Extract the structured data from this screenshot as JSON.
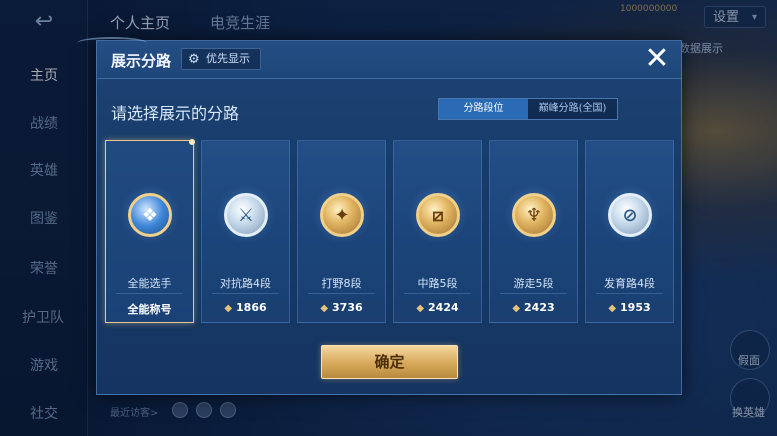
{
  "background": {
    "tabs": [
      "个人主页",
      "电竞生涯"
    ],
    "sidebar": [
      "主页",
      "战绩",
      "英雄",
      "图鉴",
      "荣誉",
      "护卫队",
      "游戏",
      "社交"
    ],
    "settings": "设置",
    "top_badge": "1000000000",
    "data_show": "和数据展示",
    "right_btn_1": "假面",
    "right_btn_2": "换英雄",
    "recent_visitors": "最近访客>"
  },
  "modal": {
    "title": "展示分路",
    "priority_label": "优先显示",
    "subtitle": "请选择展示的分路",
    "seg": [
      "分路段位",
      "巅峰分路(全国)"
    ],
    "confirm": "确定",
    "close": "✕"
  },
  "cards": [
    {
      "name": "全能选手",
      "score": "全能称号",
      "emblem_icon": "all-round-emblem",
      "glyph": "❖",
      "style": "blue-gold"
    },
    {
      "name": "对抗路4段",
      "score": "1866",
      "emblem_icon": "clash-lane-emblem",
      "glyph": "⚔",
      "style": "silver"
    },
    {
      "name": "打野8段",
      "score": "3736",
      "emblem_icon": "jungle-emblem",
      "glyph": "✦",
      "style": "gold"
    },
    {
      "name": "中路5段",
      "score": "2424",
      "emblem_icon": "mid-lane-emblem",
      "glyph": "⧄",
      "style": "gold"
    },
    {
      "name": "游走5段",
      "score": "2423",
      "emblem_icon": "roam-emblem",
      "glyph": "♆",
      "style": "gold"
    },
    {
      "name": "发育路4段",
      "score": "1953",
      "emblem_icon": "farm-lane-emblem",
      "glyph": "⊘",
      "style": "silver"
    }
  ],
  "selected_card": 0
}
